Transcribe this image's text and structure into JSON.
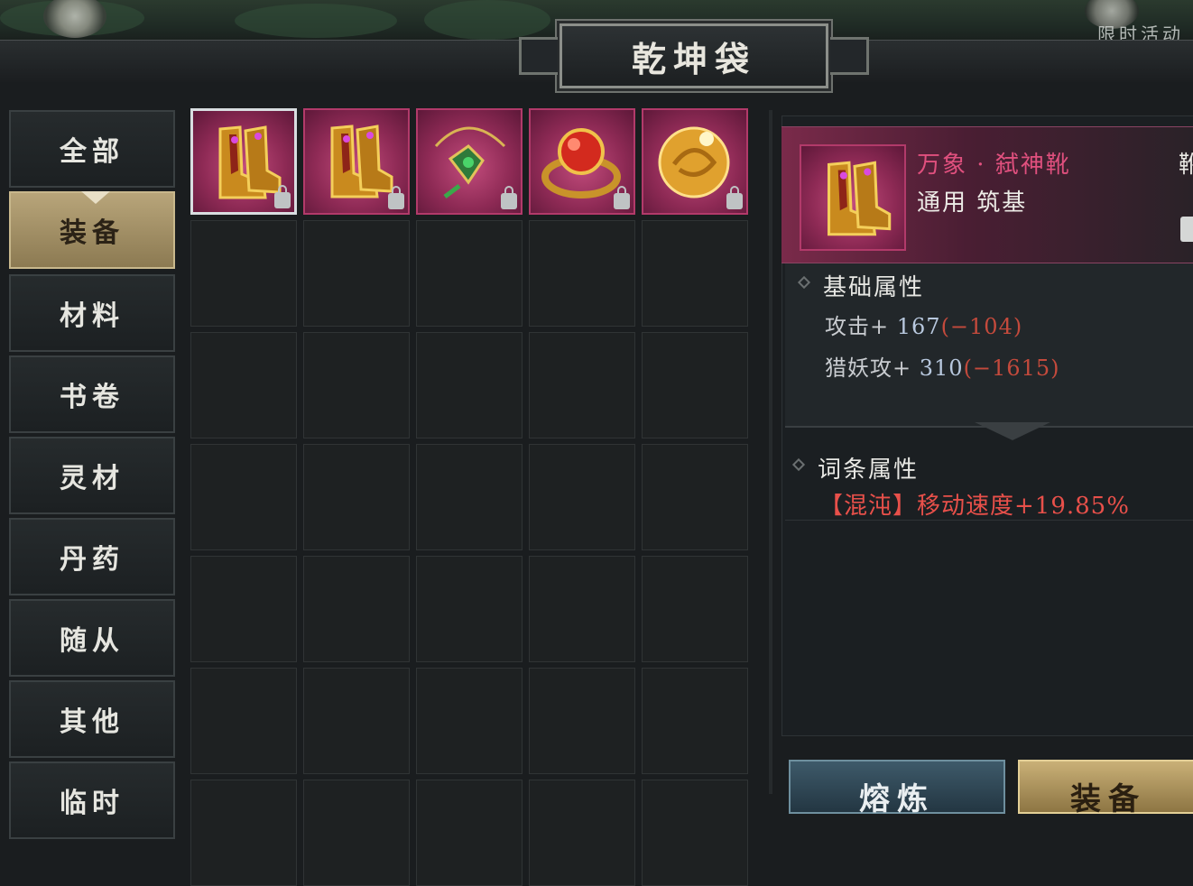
{
  "window": {
    "title": "乾坤袋"
  },
  "top_right_text": "限时活动",
  "menu": {
    "items": [
      {
        "label": "全部",
        "active": false
      },
      {
        "label": "装备",
        "active": true
      },
      {
        "label": "材料",
        "active": false
      },
      {
        "label": "书卷",
        "active": false
      },
      {
        "label": "灵材",
        "active": false
      },
      {
        "label": "丹药",
        "active": false
      },
      {
        "label": "随从",
        "active": false
      },
      {
        "label": "其他",
        "active": false
      },
      {
        "label": "临时",
        "active": false
      }
    ]
  },
  "inventory": {
    "columns": 5,
    "items": [
      {
        "icon": "boots-icon",
        "locked": true,
        "selected": true
      },
      {
        "icon": "boots-icon",
        "locked": true,
        "selected": false
      },
      {
        "icon": "necklace-icon",
        "locked": true,
        "selected": false
      },
      {
        "icon": "ring-icon",
        "locked": true,
        "selected": false
      },
      {
        "icon": "orb-icon",
        "locked": true,
        "selected": false
      }
    ]
  },
  "detail": {
    "name": "万象 · 弑神靴",
    "subtitle": "通用 筑基",
    "type_label": "靴",
    "basic_title": "基础属性",
    "stats": [
      {
        "label": "攻击+ ",
        "value": "167",
        "diff": "(−104)"
      },
      {
        "label": "猎妖攻+ ",
        "value": "310",
        "diff": "(−1615)"
      }
    ],
    "affix_title": "词条属性",
    "affix": "【混沌】移动速度+19.85%"
  },
  "buttons": {
    "left": "熔炼",
    "right": "装备"
  },
  "colors": {
    "rarity": "#e0507e",
    "negative": "#c44a3c",
    "affix": "#e8504a",
    "active_tab": "#b8a57a"
  }
}
